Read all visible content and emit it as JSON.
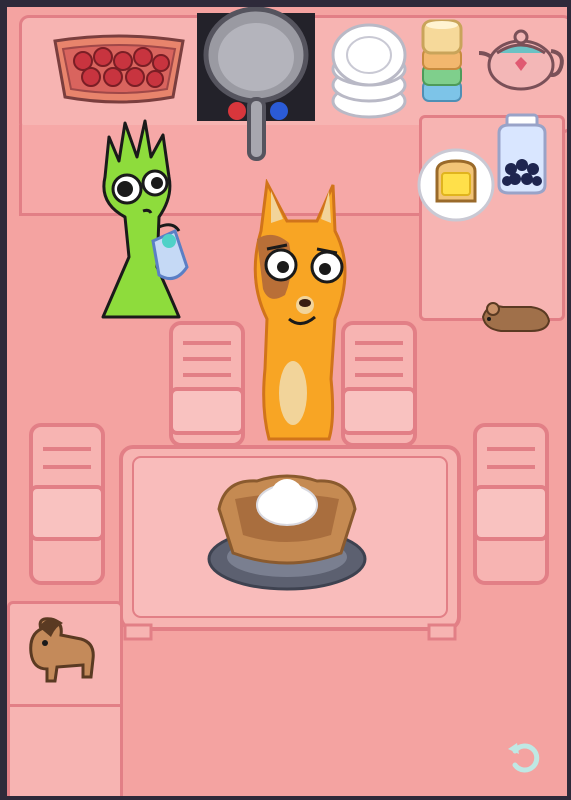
{
  "scene": {
    "background_color": "#f4a3a1",
    "furniture_color": "#f7b4b2",
    "outline_color": "#e27f86",
    "frame_color": "#2e2a3a"
  },
  "items": {
    "strawberry_basket": "strawberry-basket-icon",
    "frying_pan": "frying-pan-icon",
    "plate_stack": "plate-stack-icon",
    "cup_stack": "cup-stack-icon",
    "teapot": "teapot-icon",
    "blueberry_jar": "blueberry-jar-icon",
    "toast_plate": "toast-plate-icon",
    "pie": "cream-pie-icon",
    "mouse_toy": "mouse-toy-icon",
    "pony_toy": "pony-toy-icon"
  },
  "characters": {
    "green_character": "green-cat-character",
    "orange_character": "orange-fox-character"
  },
  "controls": {
    "reset": "reset-icon"
  }
}
